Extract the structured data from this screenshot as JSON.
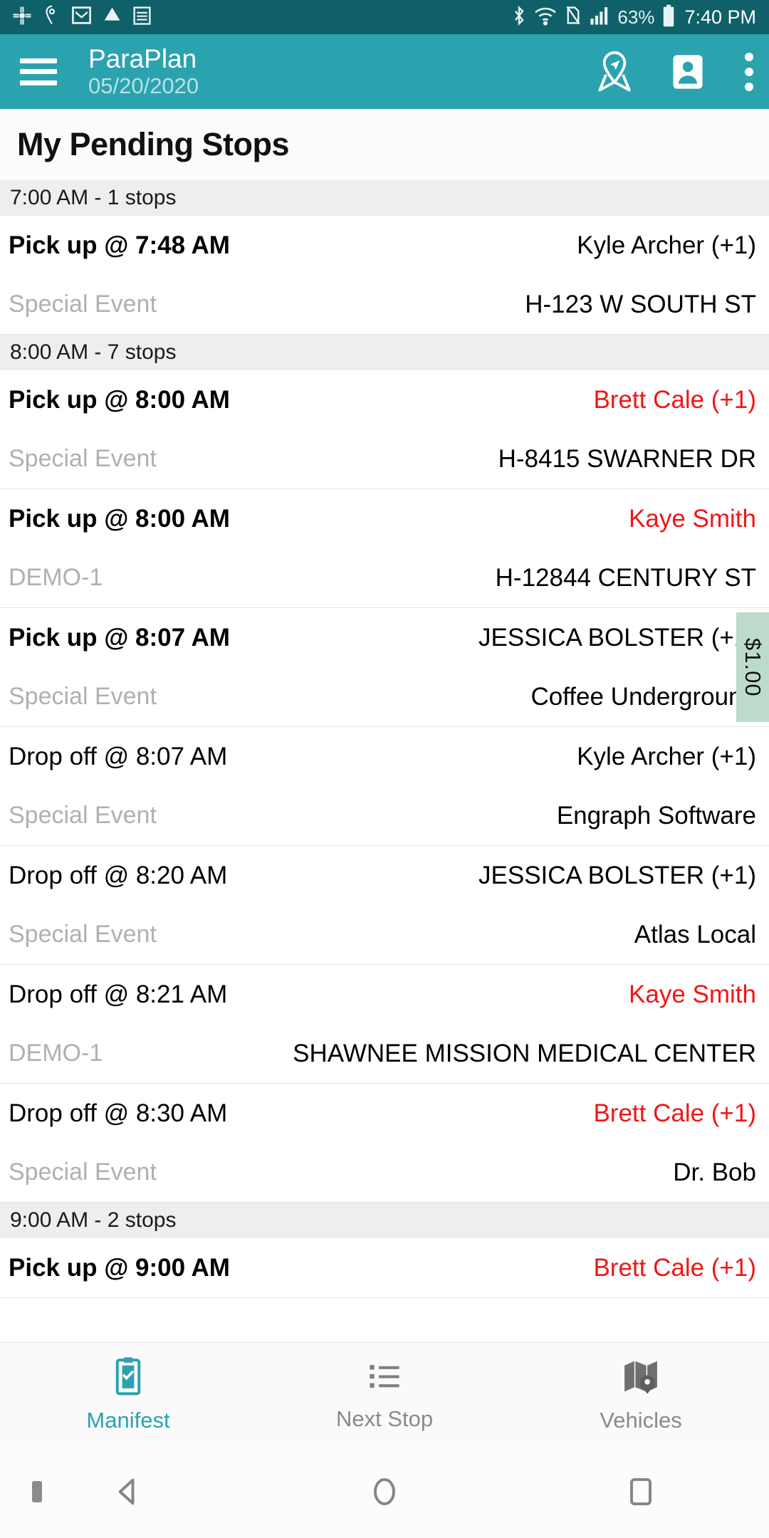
{
  "statusbar": {
    "left_icons": [
      "slack-icon",
      "location-icon",
      "gmail-icon",
      "drive-icon",
      "sheets-icon"
    ],
    "right_icons": [
      "bluetooth-icon",
      "wifi-icon",
      "no-sim-icon",
      "signal-icon"
    ],
    "battery_percent": "63%",
    "battery_icon": "battery-icon",
    "clock": "7:40 PM"
  },
  "appbar": {
    "menu_icon": "hamburger-menu-icon",
    "title": "ParaPlan",
    "date": "05/20/2020",
    "actions": [
      {
        "icon": "navigation-pin-icon"
      },
      {
        "icon": "contact-card-icon"
      },
      {
        "icon": "overflow-menu-icon"
      }
    ]
  },
  "page": {
    "title": "My Pending Stops"
  },
  "colors": {
    "accent": "#2aa3af",
    "statusbar": "#0f6068",
    "alert_red": "#f01616",
    "fare_badge_bg": "#bddbcd",
    "group_header_bg": "#eeeeee",
    "muted_text": "#b0b0b0"
  },
  "groups": [
    {
      "header": "7:00 AM - 1 stops",
      "stops": [
        {
          "action": "Pick up @ 7:48 AM",
          "action_bold": true,
          "rider": "Kyle Archer (+1)",
          "rider_alert": false,
          "event_type": "Special Event",
          "place": "H-123 W SOUTH ST",
          "fare": null
        }
      ]
    },
    {
      "header": "8:00 AM - 7 stops",
      "stops": [
        {
          "action": "Pick up @ 8:00 AM",
          "action_bold": true,
          "rider": "Brett Cale (+1)",
          "rider_alert": true,
          "event_type": "Special Event",
          "place": "H-8415 SWARNER DR",
          "fare": null
        },
        {
          "action": "Pick up @ 8:00 AM",
          "action_bold": true,
          "rider": "Kaye Smith",
          "rider_alert": true,
          "event_type": "DEMO-1",
          "place": "H-12844 CENTURY ST",
          "fare": null
        },
        {
          "action": "Pick up @ 8:07 AM",
          "action_bold": true,
          "rider": "JESSICA BOLSTER (+1)",
          "rider_alert": false,
          "event_type": "Special Event",
          "place": "Coffee Underground",
          "fare": "$1.00"
        },
        {
          "action": "Drop off @ 8:07 AM",
          "action_bold": false,
          "rider": "Kyle Archer (+1)",
          "rider_alert": false,
          "event_type": "Special Event",
          "place": "Engraph Software",
          "fare": null
        },
        {
          "action": "Drop off @ 8:20 AM",
          "action_bold": false,
          "rider": "JESSICA BOLSTER (+1)",
          "rider_alert": false,
          "event_type": "Special Event",
          "place": "Atlas Local",
          "fare": null
        },
        {
          "action": "Drop off @ 8:21 AM",
          "action_bold": false,
          "rider": "Kaye Smith",
          "rider_alert": true,
          "event_type": "DEMO-1",
          "place": "SHAWNEE MISSION MEDICAL CENTER",
          "fare": null
        },
        {
          "action": "Drop off @ 8:30 AM",
          "action_bold": false,
          "rider": "Brett Cale (+1)",
          "rider_alert": true,
          "event_type": "Special Event",
          "place": "Dr. Bob",
          "fare": null
        }
      ]
    },
    {
      "header": "9:00 AM - 2 stops",
      "stops": [
        {
          "action": "Pick up @ 9:00 AM",
          "action_bold": true,
          "rider": "Brett Cale (+1)",
          "rider_alert": true,
          "event_type": "",
          "place": "",
          "fare": null,
          "clipped": true
        }
      ]
    }
  ],
  "bottomnav": {
    "items": [
      {
        "label": "Manifest",
        "icon": "clipboard-check-icon",
        "active": true
      },
      {
        "label": "Next Stop",
        "icon": "list-icon",
        "active": false
      },
      {
        "label": "Vehicles",
        "icon": "map-pin-icon",
        "active": false
      }
    ]
  },
  "androidnav": {
    "buttons": [
      {
        "icon": "back-triangle-icon"
      },
      {
        "icon": "home-circle-icon"
      },
      {
        "icon": "recents-square-icon"
      }
    ]
  }
}
